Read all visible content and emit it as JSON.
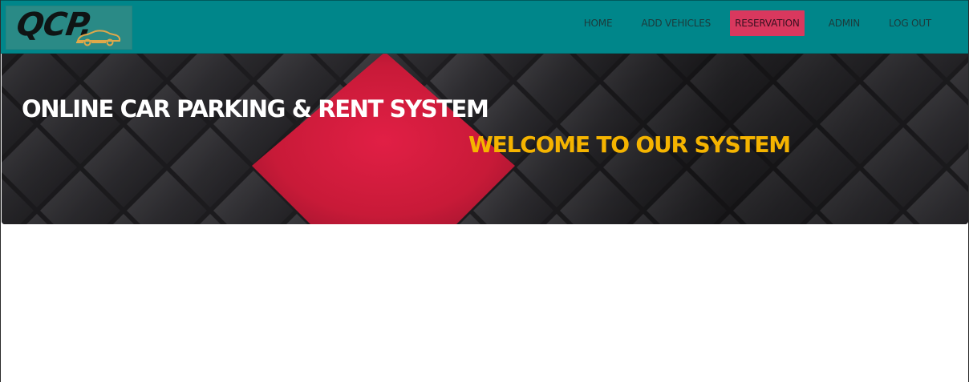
{
  "navbar": {
    "logo_text": "QCP.",
    "items": [
      {
        "label": "HOME",
        "active": false
      },
      {
        "label": "ADD VEHICLES",
        "active": false
      },
      {
        "label": "RESERVATION",
        "active": true
      },
      {
        "label": "ADMIN",
        "active": false
      },
      {
        "label": "LOG OUT",
        "active": false
      }
    ],
    "colors": {
      "background": "#00868a",
      "active_item": "#d9385e",
      "logo_car": "#e0a84a"
    }
  },
  "hero": {
    "title": "ONLINE CAR PARKING & RENT SYSTEM",
    "subtitle": "WELCOME TO OUR SYSTEM",
    "colors": {
      "title": "#ffffff",
      "subtitle": "#f5b400",
      "accent_diamond": "#d51d3f",
      "background": "#232225"
    }
  }
}
